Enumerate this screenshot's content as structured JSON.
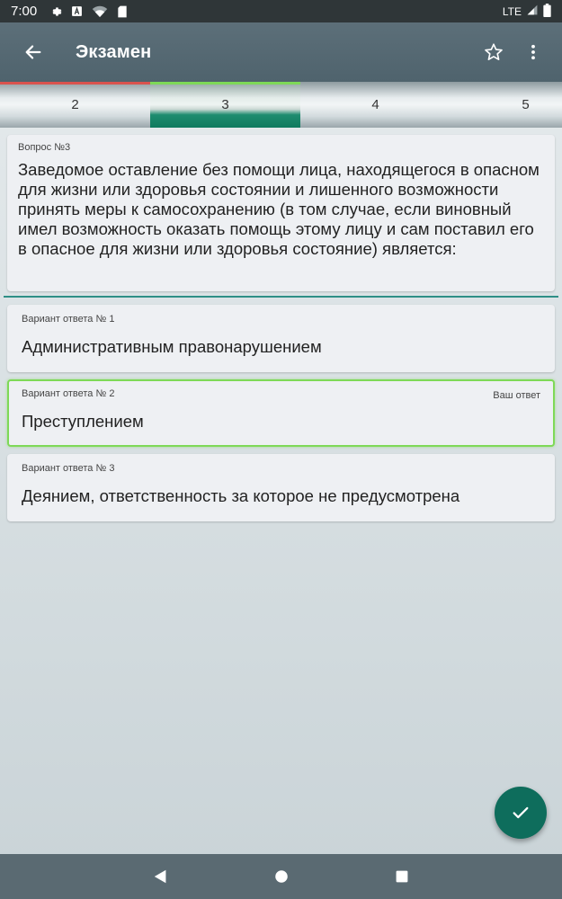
{
  "status_bar": {
    "time": "7:00",
    "network": "LTE"
  },
  "app_bar": {
    "title": "Экзамен"
  },
  "tabs": [
    {
      "label": "2",
      "top_color": "#d9534f"
    },
    {
      "label": "3",
      "top_color": "#7ed957",
      "active": true
    },
    {
      "label": "4"
    },
    {
      "label": "5"
    }
  ],
  "question": {
    "number_label": "Вопрос №3",
    "text": "Заведомое оставление без помощи лица, находящегося в опасном для жизни или здоровья состоянии и лишенного возможности принять меры к самосохранению (в том случае, если виновный имел возможность оказать помощь этому лицу и сам поставил его в опасное для жизни или здоровья состояние) является:"
  },
  "answers": [
    {
      "label": "Вариант ответа № 1",
      "text": "Административным правонарушением"
    },
    {
      "label": "Вариант ответа № 2",
      "text": "Преступлением",
      "selected_label": "Ваш ответ"
    },
    {
      "label": "Вариант ответа № 3",
      "text": "Деянием, ответственность за которое не предусмотрена"
    }
  ],
  "colors": {
    "accent": "#0e6d5c",
    "selected_border": "#7ed957",
    "app_bar": "#5a6d77"
  }
}
